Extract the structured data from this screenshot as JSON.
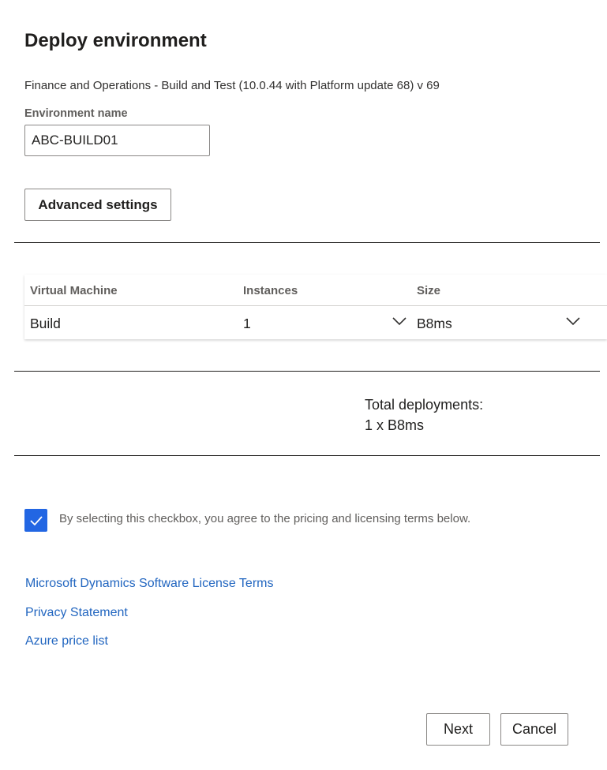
{
  "dialog": {
    "title": "Deploy environment",
    "subtitle": "Finance and Operations - Build and Test (10.0.44 with Platform update 68) v 69"
  },
  "environment_name": {
    "label": "Environment name",
    "value": "ABC-BUILD01"
  },
  "advanced_settings_label": "Advanced settings",
  "vm_table": {
    "headers": [
      "Virtual Machine",
      "Instances",
      "Size"
    ],
    "rows": [
      {
        "machine": "Build",
        "instances": "1",
        "size": "B8ms"
      }
    ]
  },
  "totals": {
    "label": "Total deployments:",
    "value": "1 x B8ms"
  },
  "agreement": {
    "checked": true,
    "text": "By selecting this checkbox, you agree to the pricing and licensing terms below."
  },
  "links": [
    "Microsoft Dynamics Software License Terms",
    "Privacy Statement",
    "Azure price list"
  ],
  "footer": {
    "next_label": "Next",
    "cancel_label": "Cancel"
  },
  "colors": {
    "accent": "#2266e3",
    "link": "#2266c0"
  },
  "icons": {
    "dropdown": "chevron-down-icon",
    "check": "checkmark-icon"
  }
}
